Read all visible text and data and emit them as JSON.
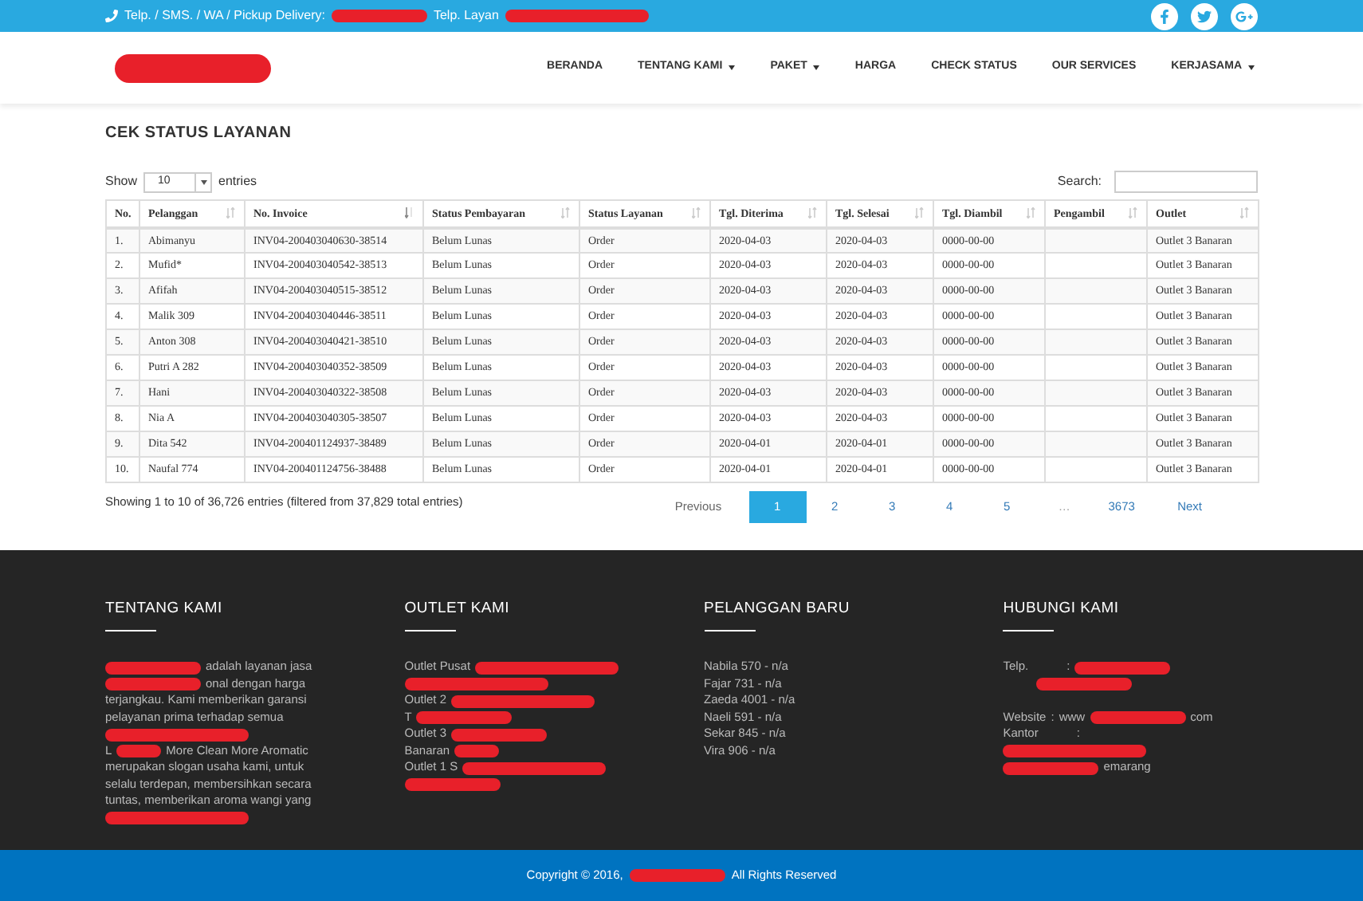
{
  "top_bar": {
    "contact_parts": [
      {
        "kind": "text",
        "text": "Telp. / SMS. / WA / Pickup Delivery:"
      },
      {
        "kind": "redact_m"
      },
      {
        "kind": "text",
        "text": "Telp. Layan"
      },
      {
        "kind": "redact_l"
      }
    ]
  },
  "header": {
    "nav": [
      {
        "label": "BERANDA",
        "dropdown": false
      },
      {
        "label": "TENTANG KAMI",
        "dropdown": true
      },
      {
        "label": "PAKET",
        "dropdown": true
      },
      {
        "label": "HARGA",
        "dropdown": false
      },
      {
        "label": "CHECK STATUS",
        "dropdown": false
      },
      {
        "label": "OUR SERVICES",
        "dropdown": false
      },
      {
        "label": "KERJASAMA",
        "dropdown": true
      }
    ]
  },
  "page_title": "CEK STATUS LAYANAN",
  "length_control": {
    "before": "Show",
    "value": "10",
    "after": "entries"
  },
  "search": {
    "label": "Search:"
  },
  "table": {
    "columns": [
      {
        "label": "No.",
        "sortable": false
      },
      {
        "label": "Pelanggan",
        "sortable": true,
        "sorted": false
      },
      {
        "label": "No. Invoice",
        "sortable": true,
        "sorted": true
      },
      {
        "label": "Status Pembayaran",
        "sortable": true,
        "sorted": false
      },
      {
        "label": "Status Layanan",
        "sortable": true,
        "sorted": false
      },
      {
        "label": "Tgl. Diterima",
        "sortable": true,
        "sorted": false
      },
      {
        "label": "Tgl. Selesai",
        "sortable": true,
        "sorted": false
      },
      {
        "label": "Tgl. Diambil",
        "sortable": true,
        "sorted": false
      },
      {
        "label": "Pengambil",
        "sortable": true,
        "sorted": false
      },
      {
        "label": "Outlet",
        "sortable": true,
        "sorted": false
      }
    ],
    "rows": [
      [
        "1.",
        "Abimanyu",
        "INV04-200403040630-38514",
        "Belum Lunas",
        "Order",
        "2020-04-03",
        "2020-04-03",
        "0000-00-00",
        "",
        "Outlet 3 Banaran"
      ],
      [
        "2.",
        "Mufid*",
        "INV04-200403040542-38513",
        "Belum Lunas",
        "Order",
        "2020-04-03",
        "2020-04-03",
        "0000-00-00",
        "",
        "Outlet 3 Banaran"
      ],
      [
        "3.",
        "Afifah",
        "INV04-200403040515-38512",
        "Belum Lunas",
        "Order",
        "2020-04-03",
        "2020-04-03",
        "0000-00-00",
        "",
        "Outlet 3 Banaran"
      ],
      [
        "4.",
        "Malik 309",
        "INV04-200403040446-38511",
        "Belum Lunas",
        "Order",
        "2020-04-03",
        "2020-04-03",
        "0000-00-00",
        "",
        "Outlet 3 Banaran"
      ],
      [
        "5.",
        "Anton 308",
        "INV04-200403040421-38510",
        "Belum Lunas",
        "Order",
        "2020-04-03",
        "2020-04-03",
        "0000-00-00",
        "",
        "Outlet 3 Banaran"
      ],
      [
        "6.",
        "Putri A 282",
        "INV04-200403040352-38509",
        "Belum Lunas",
        "Order",
        "2020-04-03",
        "2020-04-03",
        "0000-00-00",
        "",
        "Outlet 3 Banaran"
      ],
      [
        "7.",
        "Hani",
        "INV04-200403040322-38508",
        "Belum Lunas",
        "Order",
        "2020-04-03",
        "2020-04-03",
        "0000-00-00",
        "",
        "Outlet 3 Banaran"
      ],
      [
        "8.",
        "Nia A",
        "INV04-200403040305-38507",
        "Belum Lunas",
        "Order",
        "2020-04-03",
        "2020-04-03",
        "0000-00-00",
        "",
        "Outlet 3 Banaran"
      ],
      [
        "9.",
        "Dita 542",
        "INV04-200401124937-38489",
        "Belum Lunas",
        "Order",
        "2020-04-01",
        "2020-04-01",
        "0000-00-00",
        "",
        "Outlet 3 Banaran"
      ],
      [
        "10.",
        "Naufal 774",
        "INV04-200401124756-38488",
        "Belum Lunas",
        "Order",
        "2020-04-01",
        "2020-04-01",
        "0000-00-00",
        "",
        "Outlet 3 Banaran"
      ]
    ]
  },
  "table_info": "Showing 1 to 10 of 36,726 entries (filtered from 37,829 total entries)",
  "pagination": [
    {
      "label": "Previous",
      "kind": "link",
      "selected": false
    },
    {
      "label": "1",
      "kind": "page",
      "selected": true
    },
    {
      "label": "2",
      "kind": "page",
      "selected": false
    },
    {
      "label": "3",
      "kind": "page",
      "selected": false
    },
    {
      "label": "4",
      "kind": "page",
      "selected": false
    },
    {
      "label": "5",
      "kind": "page",
      "selected": false
    },
    {
      "label": "…",
      "kind": "ellipsis",
      "selected": false
    },
    {
      "label": "3673",
      "kind": "page",
      "selected": false
    },
    {
      "label": "Next",
      "kind": "link",
      "selected": false
    }
  ],
  "footer": {
    "columns": [
      {
        "title": "TENTANG KAMI",
        "lines": [
          [
            {
              "kind": "redact_m"
            },
            {
              "kind": "text",
              "text": "adalah layanan jasa"
            }
          ],
          [
            {
              "kind": "redact_m"
            },
            {
              "kind": "text",
              "text": "onal dengan harga"
            }
          ],
          [
            {
              "kind": "text",
              "text": "terjangkau. Kami memberikan garansi"
            }
          ],
          [
            {
              "kind": "text",
              "text": "pelayanan prima terhadap semua"
            }
          ],
          [
            {
              "kind": "redact_l"
            }
          ],
          [
            {
              "kind": "text",
              "text": "L"
            },
            {
              "kind": "redact_s"
            },
            {
              "kind": "text",
              "text": "More Clean More Aromatic"
            }
          ],
          [
            {
              "kind": "text",
              "text": "merupakan slogan usaha kami, untuk"
            }
          ],
          [
            {
              "kind": "text",
              "text": "selalu terdepan, membersihkan secara"
            }
          ],
          [
            {
              "kind": "text",
              "text": "tuntas, memberikan aroma wangi yang"
            }
          ],
          [
            {
              "kind": "redact_l"
            }
          ]
        ]
      },
      {
        "title": "OUTLET KAMI",
        "lines": [
          [
            {
              "kind": "text",
              "text": "Outlet Pusat"
            },
            {
              "kind": "redact_l"
            }
          ],
          [
            {
              "kind": "redact_l"
            }
          ],
          [
            {
              "kind": "text",
              "text": "Outlet 2"
            },
            {
              "kind": "redact_l"
            }
          ],
          [
            {
              "kind": "text",
              "text": "T"
            },
            {
              "kind": "redact_m"
            }
          ],
          [
            {
              "kind": "text",
              "text": "Outlet 3"
            },
            {
              "kind": "redact_m"
            }
          ],
          [
            {
              "kind": "text",
              "text": "Banaran"
            },
            {
              "kind": "redact_s"
            }
          ],
          [
            {
              "kind": "text",
              "text": "Outlet 1 S"
            },
            {
              "kind": "redact_l"
            }
          ],
          [
            {
              "kind": "redact_m"
            }
          ]
        ]
      },
      {
        "title": "PELANGGAN BARU",
        "lines": [
          [
            {
              "kind": "text",
              "text": "Nabila 570 - n/a"
            }
          ],
          [
            {
              "kind": "text",
              "text": "Fajar 731 - n/a"
            }
          ],
          [
            {
              "kind": "text",
              "text": "Zaeda 4001 - n/a"
            }
          ],
          [
            {
              "kind": "text",
              "text": "Naeli 591 - n/a"
            }
          ],
          [
            {
              "kind": "text",
              "text": "Sekar 845 - n/a"
            }
          ],
          [
            {
              "kind": "text",
              "text": "Vira 906 - n/a"
            }
          ]
        ]
      },
      {
        "title": "HUBUNGI KAMI",
        "lines": [
          [
            {
              "kind": "text",
              "text": "Telp."
            },
            {
              "kind": "tab"
            },
            {
              "kind": "text",
              "text": ":"
            },
            {
              "kind": "redact_m"
            }
          ],
          [
            {
              "kind": "tab"
            },
            {
              "kind": "redact_m"
            }
          ],
          [
            {
              "kind": "gap"
            }
          ],
          [
            {
              "kind": "text",
              "text": "Website"
            },
            {
              "kind": "text",
              "text": ":"
            },
            {
              "kind": "text",
              "text": "www"
            },
            {
              "kind": "redact_m"
            },
            {
              "kind": "text",
              "text": "com"
            }
          ],
          [
            {
              "kind": "text",
              "text": "Kantor"
            },
            {
              "kind": "tab"
            },
            {
              "kind": "text",
              "text": ":"
            }
          ],
          [
            {
              "kind": "redact_l"
            }
          ],
          [
            {
              "kind": "redact_m"
            },
            {
              "kind": "text",
              "text": "emarang"
            }
          ]
        ]
      }
    ]
  },
  "copyright": [
    {
      "kind": "text",
      "text": "Copyright © 2016,"
    },
    {
      "kind": "redact_m"
    },
    {
      "kind": "text",
      "text": "All Rights Reserved"
    }
  ]
}
